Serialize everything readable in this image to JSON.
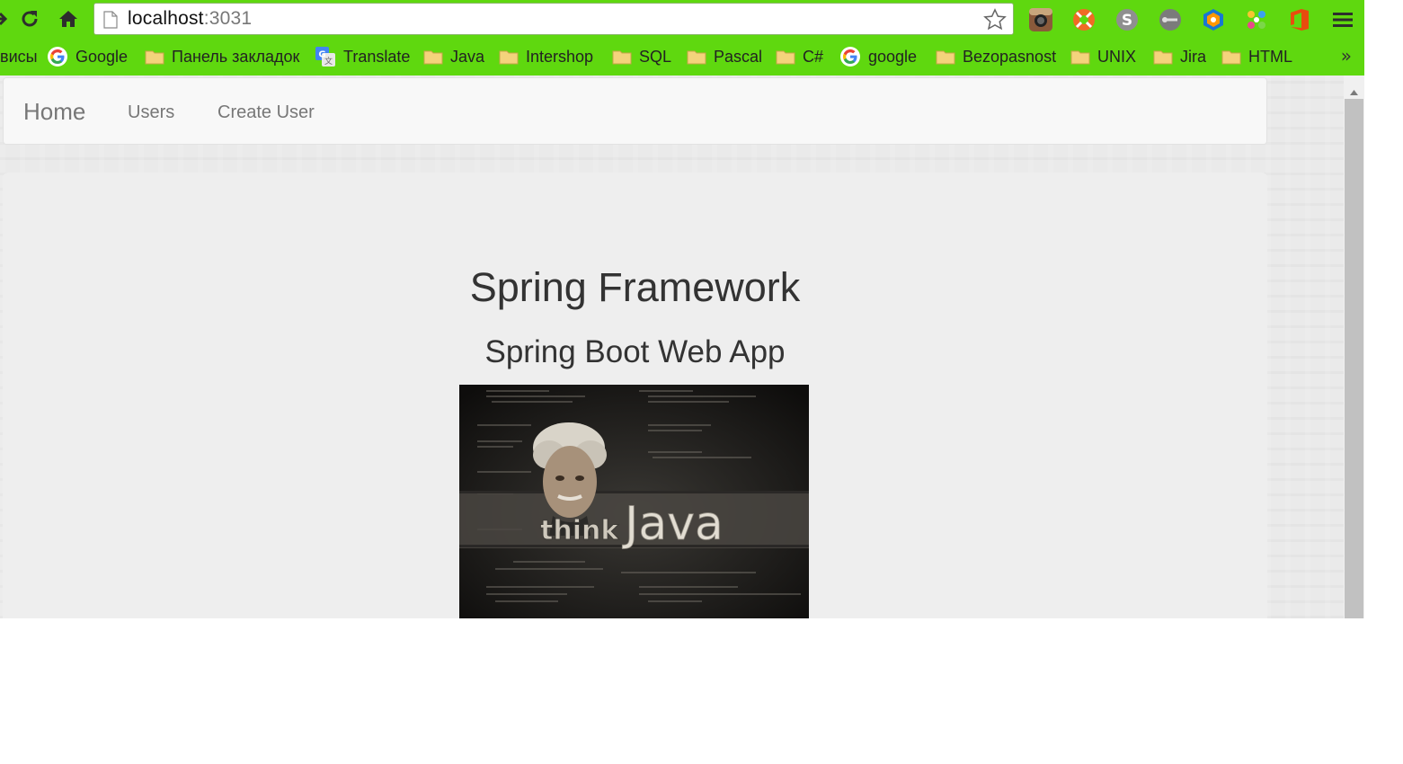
{
  "browser": {
    "url_host": "localhost",
    "url_port": ":3031"
  },
  "bookmarks": {
    "items": [
      {
        "label": "висы",
        "icon": "none"
      },
      {
        "label": "Google",
        "icon": "google-icon"
      },
      {
        "label": "Панель закладок",
        "icon": "folder-icon"
      },
      {
        "label": "Translate",
        "icon": "google-translate-icon"
      },
      {
        "label": "Java",
        "icon": "folder-icon"
      },
      {
        "label": "Intershop",
        "icon": "folder-icon"
      },
      {
        "label": "SQL",
        "icon": "folder-icon"
      },
      {
        "label": "Pascal",
        "icon": "folder-icon"
      },
      {
        "label": "C#",
        "icon": "folder-icon"
      },
      {
        "label": "google",
        "icon": "google-icon"
      },
      {
        "label": "Bezopasnost",
        "icon": "folder-icon"
      },
      {
        "label": "UNIX",
        "icon": "folder-icon"
      },
      {
        "label": "Jira",
        "icon": "folder-icon"
      },
      {
        "label": "HTML",
        "icon": "folder-icon"
      }
    ],
    "overflow": "»"
  },
  "navbar": {
    "brand": "Home",
    "links": [
      "Users",
      "Create User"
    ]
  },
  "jumbotron": {
    "title": "Spring Framework",
    "subtitle": "Spring Boot Web App",
    "image": {
      "text_think": "think",
      "text_java": "Java"
    }
  },
  "colors": {
    "toolbar_bg": "#5fd80f",
    "page_bg": "#eeeeee",
    "navbar_bg": "#f8f8f8",
    "nav_text": "#777777",
    "heading_text": "#333333"
  }
}
